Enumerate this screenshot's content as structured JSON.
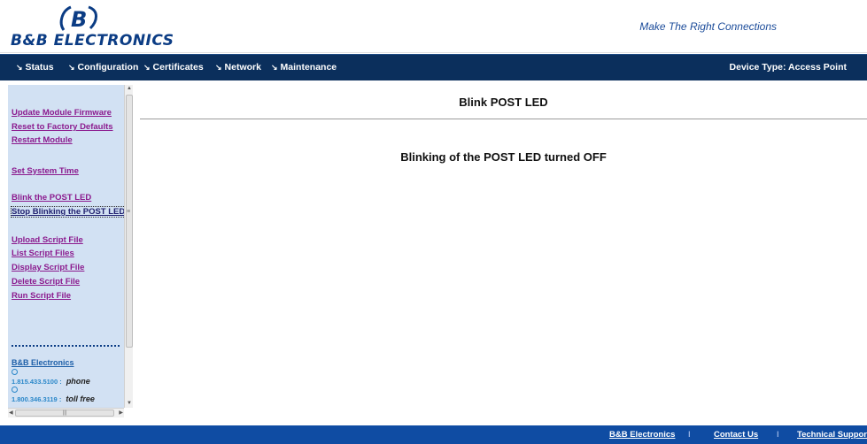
{
  "brand": {
    "logo_text": "B&B ELECTRONICS",
    "tagline": "Make The Right Connections"
  },
  "nav": {
    "items": [
      {
        "label": "Status"
      },
      {
        "label": "Configuration"
      },
      {
        "label": "Certificates"
      },
      {
        "label": "Network"
      },
      {
        "label": "Maintenance"
      }
    ],
    "device_type": "Device Type: Access Point"
  },
  "sidebar": {
    "links": [
      {
        "label": "Update Module Firmware"
      },
      {
        "label": "Reset to Factory Defaults"
      },
      {
        "label": "Restart Module"
      },
      {
        "label": "Set System Time"
      },
      {
        "label": "Blink the POST LED"
      },
      {
        "label": "Stop Blinking the POST LED"
      },
      {
        "label": "Upload Script File"
      },
      {
        "label": "List Script Files"
      },
      {
        "label": "Display Script File"
      },
      {
        "label": "Delete Script File"
      },
      {
        "label": "Run Script File"
      }
    ],
    "company": "B&B Electronics",
    "phones": [
      {
        "number": "1.815.433.5100",
        "label": "phone"
      },
      {
        "number": "1.800.346.3119",
        "label": "toll free"
      }
    ]
  },
  "main": {
    "title": "Blink POST LED",
    "message": "Blinking of the POST LED turned OFF"
  },
  "footer": {
    "links": [
      {
        "label": "B&B Electronics"
      },
      {
        "label": "Contact Us"
      },
      {
        "label": "Technical Support"
      }
    ],
    "separator": "I"
  },
  "colors": {
    "nav_bg": "#0b2f5c",
    "footer_bg": "#0f4ca3",
    "sidebar_bg": "#d2e1f3",
    "link_purple": "#8b1a8e",
    "brand_blue": "#0b3c84"
  }
}
